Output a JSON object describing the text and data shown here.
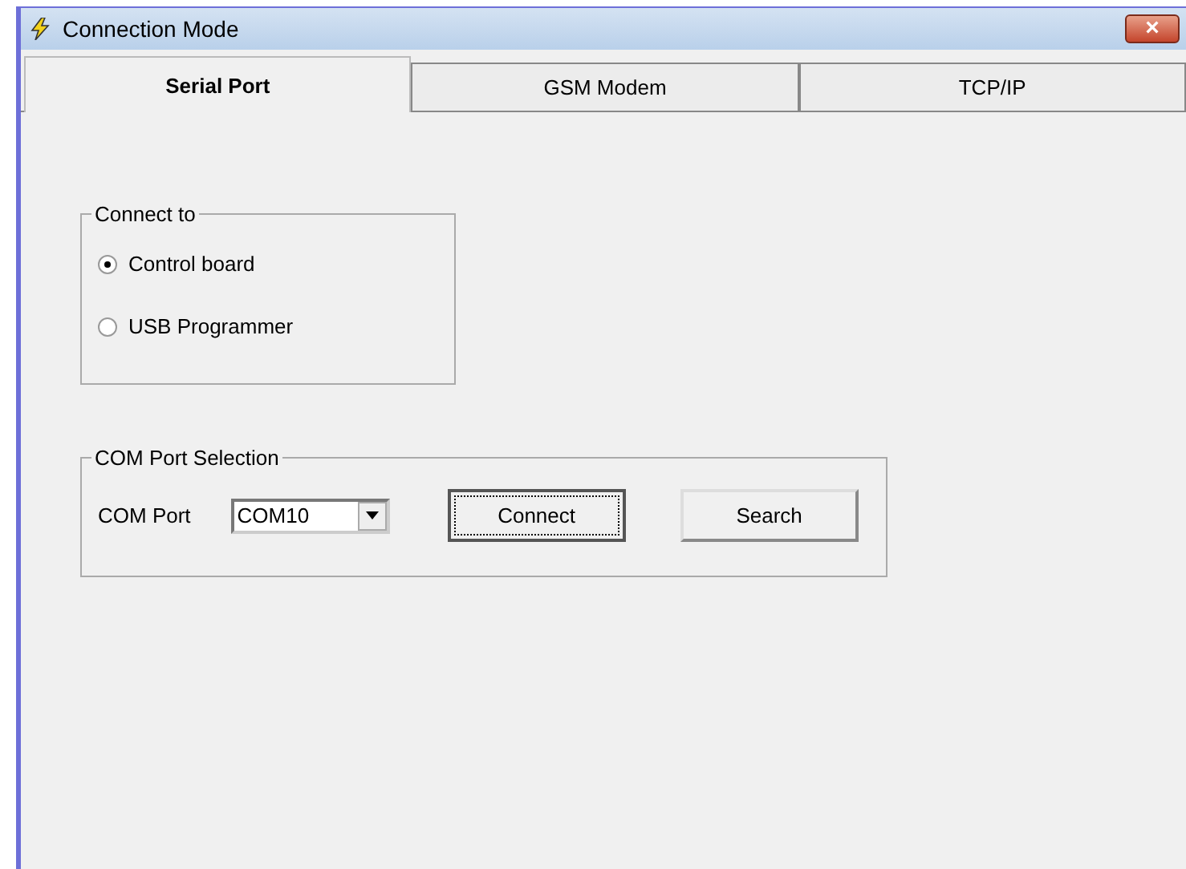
{
  "window": {
    "title": "Connection Mode",
    "close_label": "×"
  },
  "tabs": [
    {
      "label": "Serial Port",
      "selected": true
    },
    {
      "label": "GSM Modem",
      "selected": false
    },
    {
      "label": "TCP/IP",
      "selected": false
    }
  ],
  "connect_to": {
    "title": "Connect to",
    "options": [
      {
        "label": "Control board",
        "selected": true
      },
      {
        "label": "USB Programmer",
        "selected": false
      }
    ]
  },
  "com_port_selection": {
    "title": "COM Port Selection",
    "label": "COM Port",
    "value": "COM10",
    "buttons": [
      {
        "label": "Connect",
        "focused": true
      },
      {
        "label": "Search",
        "focused": false
      }
    ]
  }
}
